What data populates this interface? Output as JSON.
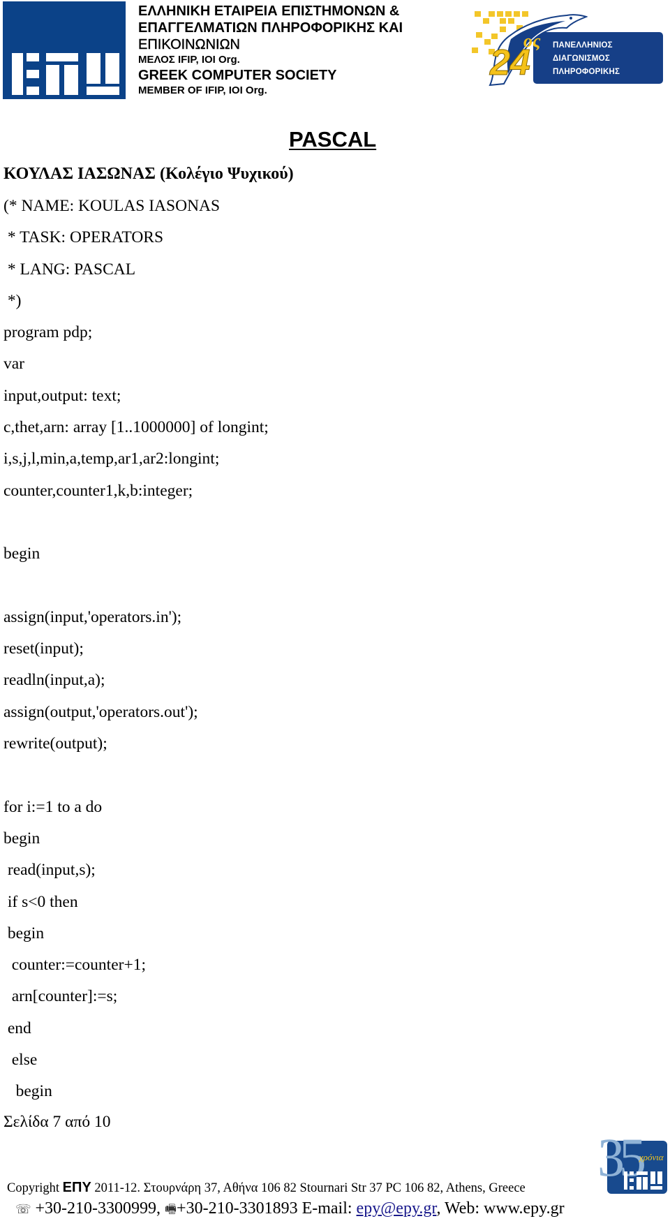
{
  "header": {
    "org_greek_line1": "ΕΛΛΗΝΙΚΗ ΕΤΑΙΡΕΙΑ ΕΠΙΣΤΗΜΟΝΩΝ &",
    "org_greek_line2": "ΕΠΑΓΓΕΛΜΑΤΙΩΝ ΠΛΗΡΟΦΟΡΙΚΗΣ ΚΑΙ",
    "org_greek_line3": "ΕΠΙΚΟΙΝΩΝΙΩΝ",
    "member_greek": "ΜΕΛΟΣ IFIP, IOI Org.",
    "org_english": "GREEK COMPUTER SOCIETY",
    "member_english": "MEMBER OF IFIP, IOI Org.",
    "contest_logo": {
      "number": "24",
      "ordinal": "ος",
      "line1": "ΠΑΝΕΛΛΗΝΙΟΣ",
      "line2": "ΔΙΑΓΩΝΙΣΜΟΣ",
      "line3": "ΠΛΗΡΟΦΟΡΙΚΗΣ"
    },
    "colors": {
      "brand_blue": "#0b4288",
      "accent_yellow": "#f5c21a"
    }
  },
  "document": {
    "language_title": "PASCAL",
    "author_line": "ΚΟΥΛΑΣ ΙΑΣΩΝΑΣ (Κολέγιο Ψυχικού)",
    "code_lines": [
      "(* NAME: KOULAS IASONAS",
      " * TASK: OPERATORS",
      " * LANG: PASCAL",
      " *)",
      "program pdp;",
      "var",
      "input,output: text;",
      "c,thet,arn: array [1..1000000] of longint;",
      "i,s,j,l,min,a,temp,ar1,ar2:longint;",
      "counter,counter1,k,b:integer;",
      "",
      "begin",
      "",
      "assign(input,'operators.in');",
      "reset(input);",
      "readln(input,a);",
      "assign(output,'operators.out');",
      "rewrite(output);",
      "",
      "for i:=1 to a do",
      "begin",
      " read(input,s);",
      " if s<0 then",
      " begin",
      "  counter:=counter+1;",
      "  arn[counter]:=s;",
      " end",
      "  else",
      "   begin"
    ],
    "page_indicator": "Σελίδα 7 από 10"
  },
  "footer": {
    "copyright_prefix": "Copyright ",
    "brand": "ΕΠΥ",
    "copyright_rest": " 2011-12. Στουρνάρη 37, Αθήνα 106 82 Stournari Str 37 PC 106 82, Athens, Greece",
    "phone_icon": "telephone-icon",
    "phone": " +30-210-3300999, ",
    "fax_icon": "fax-icon",
    "fax": "+30-210-3301893 E-mail: ",
    "email": "epy@epy.gr",
    "web": ", Web: www.epy.gr",
    "anniversary_logo": {
      "number": "35",
      "caption": "χρόνια"
    }
  }
}
